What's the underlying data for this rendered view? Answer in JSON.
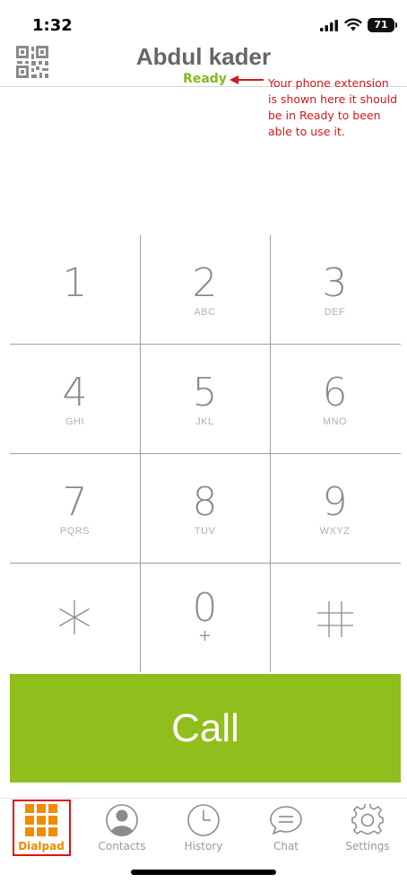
{
  "status_bar": {
    "time": "1:32",
    "battery": "71"
  },
  "header": {
    "user_name": "Abdul kader",
    "status": "Ready",
    "status_color": "#86b81c"
  },
  "annotation": {
    "lines": [
      "Your phone extension",
      "is shown here it should",
      " be in Ready to been",
      "able to use it."
    ],
    "color": "#d01818"
  },
  "dialpad": {
    "keys": [
      {
        "digit": "1",
        "letters": ""
      },
      {
        "digit": "2",
        "letters": "ABC"
      },
      {
        "digit": "3",
        "letters": "DEF"
      },
      {
        "digit": "4",
        "letters": "GHI"
      },
      {
        "digit": "5",
        "letters": "JKL"
      },
      {
        "digit": "6",
        "letters": "MNO"
      },
      {
        "digit": "7",
        "letters": "PQRS"
      },
      {
        "digit": "8",
        "letters": "TUV"
      },
      {
        "digit": "9",
        "letters": "WXYZ"
      },
      {
        "digit": "*",
        "letters": ""
      },
      {
        "digit": "0",
        "letters": "+"
      },
      {
        "digit": "#",
        "letters": ""
      }
    ]
  },
  "call_button": {
    "label": "Call",
    "color": "#8fbe1d"
  },
  "tabs": [
    {
      "label": "Dialpad",
      "icon": "dialpad-grid-icon",
      "active": true
    },
    {
      "label": "Contacts",
      "icon": "contact-person-icon",
      "active": false
    },
    {
      "label": "History",
      "icon": "clock-icon",
      "active": false
    },
    {
      "label": "Chat",
      "icon": "chat-bubble-icon",
      "active": false
    },
    {
      "label": "Settings",
      "icon": "gear-icon",
      "active": false
    }
  ],
  "colors": {
    "accent_orange": "#f08c00",
    "highlight_red": "#e01010"
  }
}
